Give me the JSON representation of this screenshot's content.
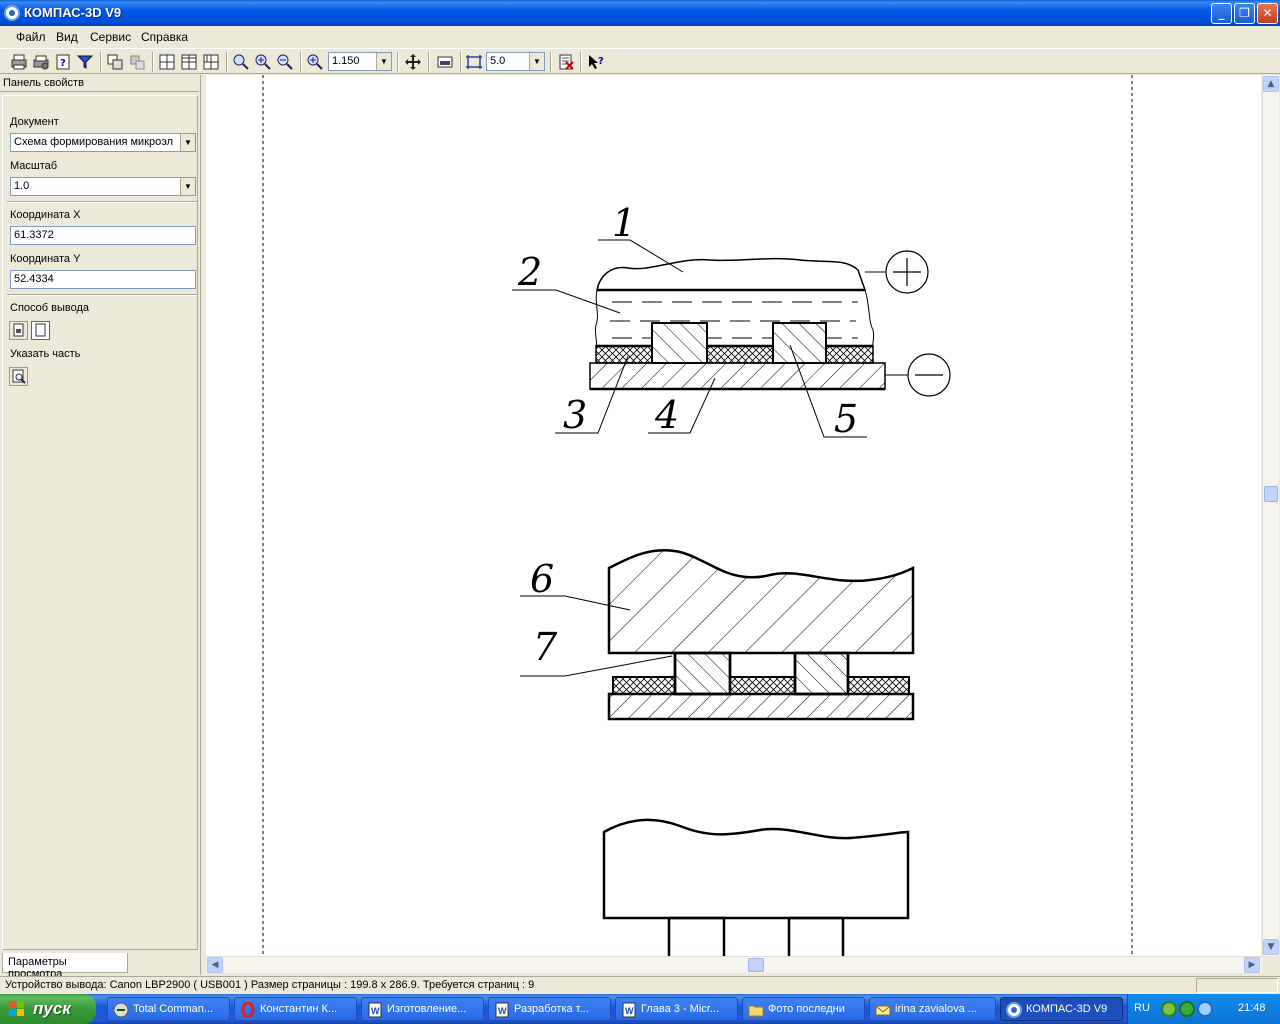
{
  "window": {
    "title": "КОМПАС-3D V9",
    "buttons": [
      "_",
      "❐",
      "✕"
    ]
  },
  "menu": [
    "Файл",
    "Вид",
    "Сервис",
    "Справка"
  ],
  "toolbar": {
    "zoom_value": "1.150",
    "step_value": "5.0",
    "icons": [
      "print-icon",
      "print-setup-icon",
      "help-doc-icon",
      "filter-icon",
      "copy-layout-icon",
      "layout-icon",
      "grid-1-icon",
      "grid-2-icon",
      "grid-3-icon",
      "zoom-window-icon",
      "zoom-in-icon",
      "zoom-out-icon",
      "zoom-scale-icon",
      "pan-icon",
      "page-view-icon",
      "snap-step-icon",
      "print-preview-close-icon",
      "context-help-icon"
    ]
  },
  "panel": {
    "header": "Панель свойств",
    "document_label": "Документ",
    "document_value": "Схема формирования микроэл",
    "scale_label": "Масштаб",
    "scale_value": "1.0",
    "coord_x_label": "Координата X",
    "coord_x_value": "61.3372",
    "coord_y_label": "Координата Y",
    "coord_y_value": "52.4334",
    "output_label": "Способ вывода",
    "part_label": "Указать часть",
    "tab_label": "Параметры просмотра"
  },
  "drawing": {
    "callouts": [
      "1",
      "2",
      "3",
      "4",
      "5",
      "6",
      "7"
    ],
    "plus_symbol": "+",
    "minus_symbol": "−"
  },
  "statusbar": {
    "text": "Устройство вывода: Canon LBP2900 ( USB001 )  Размер страницы : 199.8 x 286.9.  Требуется страниц : 9"
  },
  "taskbar": {
    "start": "пуск",
    "tasks": [
      {
        "label": "Total Comman...",
        "icon": "total-commander-icon"
      },
      {
        "label": "Константин К...",
        "icon": "opera-icon"
      },
      {
        "label": "Изготовление...",
        "icon": "word-icon"
      },
      {
        "label": "Разработка т...",
        "icon": "word-icon"
      },
      {
        "label": "Глава 3 - Micr...",
        "icon": "word-icon"
      },
      {
        "label": "Фото последни",
        "icon": "folder-icon"
      },
      {
        "label": "irina zavialova ...",
        "icon": "mail-icon"
      },
      {
        "label": "КОМПАС-3D V9",
        "icon": "kompas-icon"
      }
    ],
    "lang": "RU",
    "time": "21:48"
  }
}
